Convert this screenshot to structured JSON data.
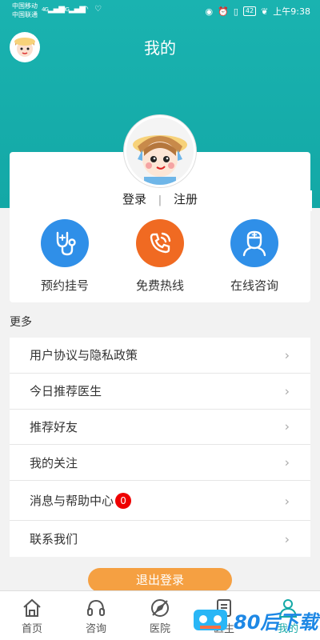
{
  "status_bar": {
    "carrier1": "中国移动",
    "carrier2": "中国联通",
    "net1": "4G",
    "net2": "3G",
    "battery": "42",
    "time": "上午9:38"
  },
  "header": {
    "title": "我的"
  },
  "account": {
    "login": "登录",
    "separator": "|",
    "register": "注册"
  },
  "quick_actions": [
    {
      "label": "预约挂号",
      "icon": "stethoscope-icon",
      "color": "#2f8fe8"
    },
    {
      "label": "免费热线",
      "icon": "phone-icon",
      "color": "#f06a22"
    },
    {
      "label": "在线咨询",
      "icon": "doctor-icon",
      "color": "#2f8fe8"
    }
  ],
  "more_label": "更多",
  "menu": [
    {
      "label": "用户协议与隐私政策"
    },
    {
      "label": "今日推荐医生"
    },
    {
      "label": "推荐好友"
    },
    {
      "label": "我的关注"
    },
    {
      "label": "消息与帮助中心",
      "badge": "0"
    },
    {
      "label": "联系我们"
    }
  ],
  "logout_label": "退出登录",
  "tabs": [
    {
      "label": "首页",
      "icon": "home-icon"
    },
    {
      "label": "咨询",
      "icon": "headset-icon"
    },
    {
      "label": "医院",
      "icon": "compass-icon"
    },
    {
      "label": "医生",
      "icon": "doctor-list-icon"
    },
    {
      "label": "我的",
      "icon": "user-icon",
      "active": true
    }
  ],
  "watermark": "80后下载",
  "colors": {
    "primary": "#15a9a7",
    "logout": "#f5a042",
    "badge": "#e00000"
  }
}
